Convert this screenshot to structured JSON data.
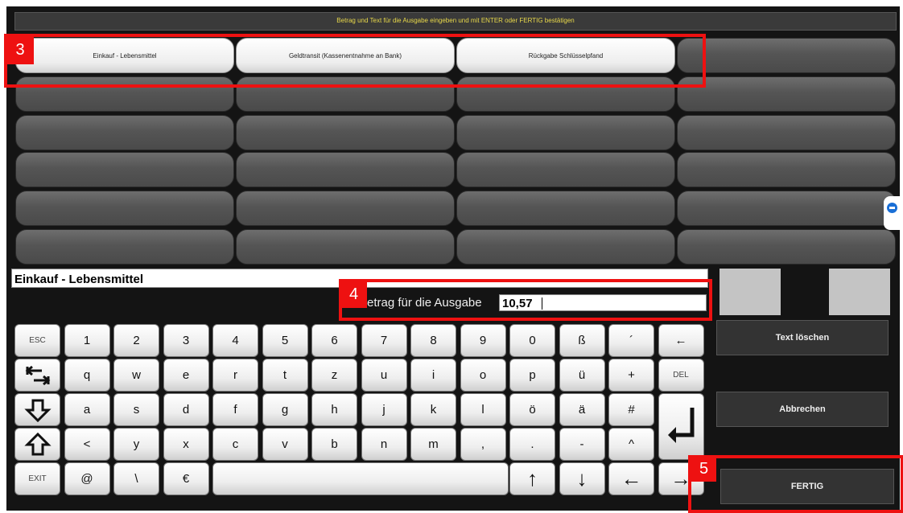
{
  "header": {
    "instruction": "Betrag und Text für die Ausgabe eingeben und mit ENTER oder FERTIG bestätigen"
  },
  "tiles": [
    "Einkauf - Lebensmittel",
    "Geldtransit (Kassenentnahme an Bank)",
    "Rückgabe Schlüsselpfand"
  ],
  "form": {
    "description": "Einkauf - Lebensmittel",
    "amount_label": "Betrag für die Ausgabe",
    "amount_value": "10,57"
  },
  "keyboard": {
    "row1": [
      "ESC",
      "1",
      "2",
      "3",
      "4",
      "5",
      "6",
      "7",
      "8",
      "9",
      "0",
      "ß",
      "´",
      "←"
    ],
    "row2": [
      "q",
      "w",
      "e",
      "r",
      "t",
      "z",
      "u",
      "i",
      "o",
      "p",
      "ü",
      "+",
      "DEL"
    ],
    "row3": [
      "a",
      "s",
      "d",
      "f",
      "g",
      "h",
      "j",
      "k",
      "l",
      "ö",
      "ä",
      "#"
    ],
    "row4": [
      "<",
      "y",
      "x",
      "c",
      "v",
      "b",
      "n",
      "m",
      ",",
      ".",
      "-",
      "^"
    ],
    "row5": [
      "EXIT",
      "@",
      "\\",
      "€",
      "↑",
      "↓",
      "←",
      "→"
    ]
  },
  "side": {
    "text_loeschen": "Text löschen",
    "abbrechen": "Abbrechen",
    "fertig": "FERTIG"
  },
  "callouts": [
    "3",
    "4",
    "5"
  ],
  "icons": [
    "tab-icon",
    "arrow-down-outline-icon",
    "shift-icon",
    "enter-icon",
    "teamviewer-icon"
  ],
  "colors": {
    "header_text": "#e8d84a",
    "callout": "#e11111"
  }
}
